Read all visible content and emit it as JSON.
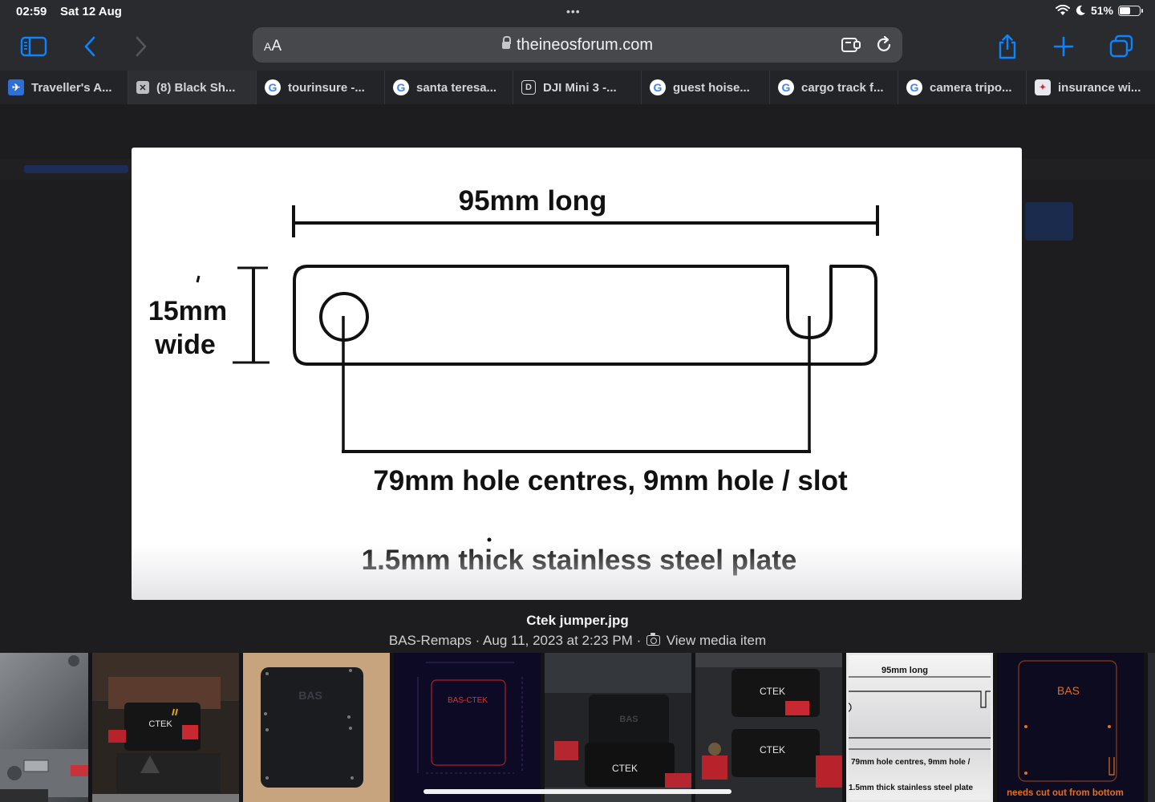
{
  "status_bar": {
    "time": "02:59",
    "date": "Sat 12 Aug",
    "dots": "•••",
    "battery": "51%"
  },
  "toolbar": {
    "text_size_label_small": "A",
    "text_size_label_large": "A",
    "url": "theineosforum.com"
  },
  "tabs": [
    {
      "title": "Traveller's A...",
      "favicon": "travel-favicon-icon",
      "active": false
    },
    {
      "title": "(8) Black Sh...",
      "favicon": "x-favicon-icon",
      "active": true
    },
    {
      "title": "tourinsure -...",
      "favicon": "google-favicon-icon",
      "active": false
    },
    {
      "title": "santa teresa...",
      "favicon": "google-favicon-icon",
      "active": false
    },
    {
      "title": "DJI Mini 3 -...",
      "favicon": "d-favicon-icon",
      "active": false
    },
    {
      "title": "guest hoise...",
      "favicon": "google-favicon-icon",
      "active": false
    },
    {
      "title": "cargo track f...",
      "favicon": "google-favicon-icon",
      "active": false
    },
    {
      "title": "camera tripo...",
      "favicon": "google-favicon-icon",
      "active": false
    },
    {
      "title": "insurance wi...",
      "favicon": "insurance-favicon-icon",
      "active": false
    }
  ],
  "diagram": {
    "length_label": "95mm long",
    "width_label_line1": "15mm",
    "width_label_line2": "wide",
    "holes_label": "79mm hole centres, 9mm hole / slot",
    "material_label": "1.5mm thick stainless steel plate"
  },
  "caption": {
    "filename": "Ctek jumper.jpg",
    "meta": "BAS-Remaps · Aug 11, 2023 at 2:23 PM ·",
    "view_link": "View media item"
  },
  "thumbnails": [
    {
      "label": "",
      "brand": ""
    },
    {
      "label": "",
      "brand": "CTEK"
    },
    {
      "label": "",
      "brand": "BAS"
    },
    {
      "label": "",
      "brand": "BAS-CTEK"
    },
    {
      "label": "",
      "brand": "BAS"
    },
    {
      "label": "",
      "brand": "CTEK"
    },
    {
      "label": "",
      "brand": "95mm long",
      "line2": "79mm hole centres, 9mm hole /",
      "line3": "1.5mm thick stainless steel plate"
    },
    {
      "label": "needs cut out from bottom",
      "brand": "BAS"
    }
  ],
  "colors": {
    "accent_blue": "#0a84ff",
    "chrome_bg": "#2a2b2f",
    "address_bg": "#47484c",
    "drawing_orange": "#e56d1f"
  }
}
